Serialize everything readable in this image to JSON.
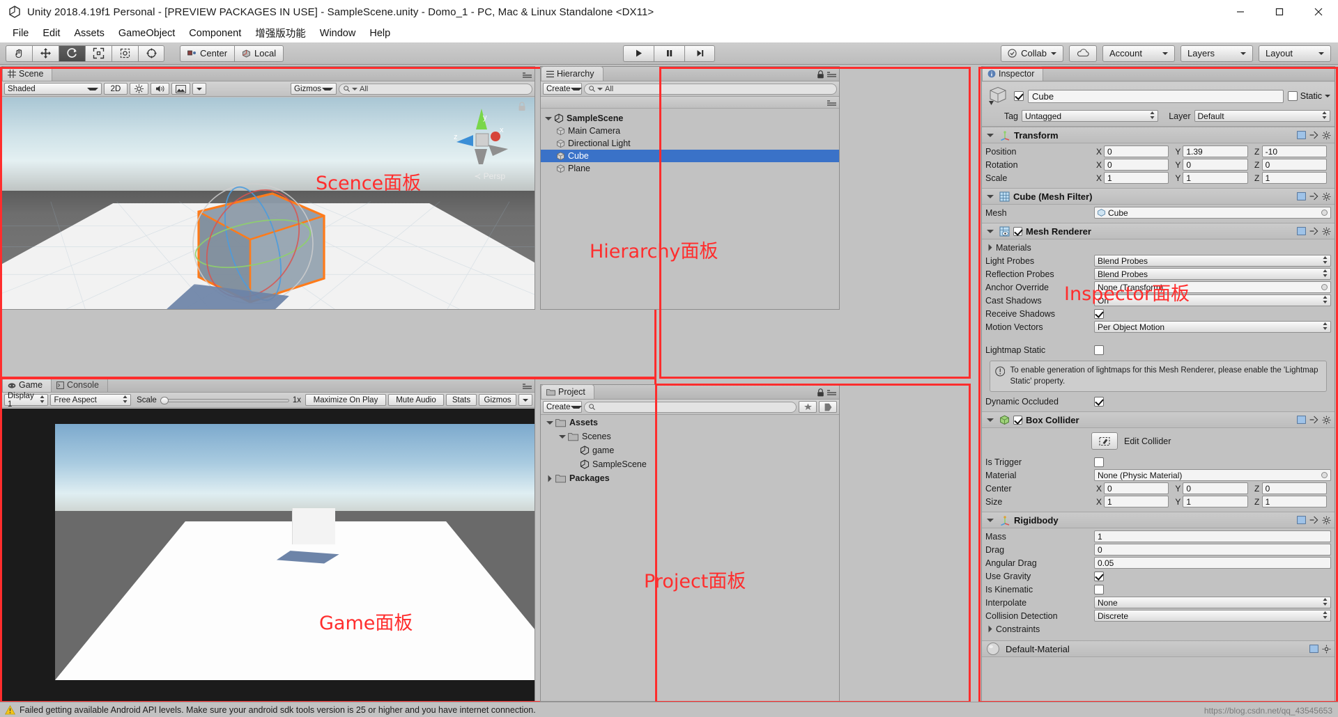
{
  "window": {
    "title": "Unity 2018.4.19f1 Personal - [PREVIEW PACKAGES IN USE] - SampleScene.unity - Domo_1 - PC, Mac & Linux Standalone <DX11>",
    "minimize_label": "Minimize",
    "maximize_label": "Maximize",
    "close_label": "Close"
  },
  "menu": {
    "items": [
      "File",
      "Edit",
      "Assets",
      "GameObject",
      "Component",
      "增强版功能",
      "Window",
      "Help"
    ]
  },
  "toolbar": {
    "tools": [
      "hand-tool",
      "move-tool",
      "rotate-tool",
      "scale-tool",
      "rect-tool",
      "transform-tool"
    ],
    "active_tool_index": 2,
    "pivot_label": "Center",
    "space_label": "Local",
    "play_label": "Play",
    "pause_label": "Pause",
    "step_label": "Step",
    "collab_label": "Collab",
    "cloud_label": "Services",
    "account_label": "Account",
    "layers_label": "Layers",
    "layout_label": "Layout"
  },
  "scene": {
    "tab_label": "Scene",
    "shading_mode": "Shaded",
    "mode_2d": "2D",
    "gizmos_label": "Gizmos",
    "search_placeholder": "All",
    "perspective_label": "Persp",
    "axis_labels": {
      "x": "x",
      "y": "y",
      "z": "z"
    },
    "annotation": "Scence面板"
  },
  "hierarchy": {
    "tab_label": "Hierarchy",
    "create_label": "Create",
    "search_placeholder": "All",
    "items": [
      {
        "label": "SampleScene",
        "depth": 0,
        "icon": "unity-icon",
        "selected": false,
        "expanded": true
      },
      {
        "label": "Main Camera",
        "depth": 1,
        "icon": "gameobject-icon",
        "selected": false
      },
      {
        "label": "Directional Light",
        "depth": 1,
        "icon": "gameobject-icon",
        "selected": false
      },
      {
        "label": "Cube",
        "depth": 1,
        "icon": "gameobject-icon",
        "selected": true
      },
      {
        "label": "Plane",
        "depth": 1,
        "icon": "gameobject-icon",
        "selected": false
      }
    ],
    "annotation": "Hierarchy面板"
  },
  "game": {
    "tab_label": "Game",
    "console_tab_label": "Console",
    "display_label": "Display 1",
    "aspect_label": "Free Aspect",
    "scale_label": "Scale",
    "scale_value": "1x",
    "maximize_label": "Maximize On Play",
    "mute_label": "Mute Audio",
    "stats_label": "Stats",
    "gizmos_label": "Gizmos",
    "annotation": "Game面板"
  },
  "project": {
    "tab_label": "Project",
    "create_label": "Create",
    "search_placeholder": "",
    "items": [
      {
        "label": "Assets",
        "depth": 0,
        "icon": "folder-icon",
        "expanded": true,
        "bold": true
      },
      {
        "label": "Scenes",
        "depth": 1,
        "icon": "folder-icon",
        "expanded": true,
        "bold": false
      },
      {
        "label": "game",
        "depth": 2,
        "icon": "unity-scene-icon",
        "bold": false
      },
      {
        "label": "SampleScene",
        "depth": 2,
        "icon": "unity-scene-icon",
        "bold": false
      },
      {
        "label": "Packages",
        "depth": 0,
        "icon": "folder-icon",
        "expanded": false,
        "bold": true
      }
    ],
    "annotation": "Project面板"
  },
  "inspector": {
    "tab_label": "Inspector",
    "annotation": "Inspector面板",
    "object_name": "Cube",
    "object_enabled": true,
    "static_label": "Static",
    "static_checked": false,
    "tag_label": "Tag",
    "tag_value": "Untagged",
    "layer_label": "Layer",
    "layer_value": "Default",
    "components": [
      {
        "name": "Transform",
        "icon": "transform-icon",
        "enabled_toggle": false,
        "rows": [
          {
            "type": "vec3",
            "label": "Position",
            "x": "0",
            "y": "1.39",
            "z": "-10"
          },
          {
            "type": "vec3",
            "label": "Rotation",
            "x": "0",
            "y": "0",
            "z": "0"
          },
          {
            "type": "vec3",
            "label": "Scale",
            "x": "1",
            "y": "1",
            "z": "1"
          }
        ]
      },
      {
        "name": "Cube (Mesh Filter)",
        "icon": "mesh-filter-icon",
        "enabled_toggle": false,
        "rows": [
          {
            "type": "object",
            "label": "Mesh",
            "value": "Cube"
          }
        ]
      },
      {
        "name": "Mesh Renderer",
        "icon": "mesh-renderer-icon",
        "enabled_toggle": true,
        "enabled": true,
        "rows": [
          {
            "type": "foldout",
            "label": "Materials"
          },
          {
            "type": "popup",
            "label": "Light Probes",
            "value": "Blend Probes"
          },
          {
            "type": "popup",
            "label": "Reflection Probes",
            "value": "Blend Probes"
          },
          {
            "type": "object",
            "label": "Anchor Override",
            "value": "None (Transform)"
          },
          {
            "type": "popup",
            "label": "Cast Shadows",
            "value": "On"
          },
          {
            "type": "checkbox",
            "label": "Receive Shadows",
            "checked": true
          },
          {
            "type": "popup",
            "label": "Motion Vectors",
            "value": "Per Object Motion"
          },
          {
            "type": "checkbox",
            "label": "Lightmap Static",
            "checked": false
          },
          {
            "type": "infobox",
            "text": "To enable generation of lightmaps for this Mesh Renderer, please enable the 'Lightmap Static' property."
          },
          {
            "type": "checkbox",
            "label": "Dynamic Occluded",
            "checked": true
          }
        ]
      },
      {
        "name": "Box Collider",
        "icon": "box-collider-icon",
        "enabled_toggle": true,
        "enabled": true,
        "rows": [
          {
            "type": "editcollider",
            "label": "Edit Collider"
          },
          {
            "type": "checkbox",
            "label": "Is Trigger",
            "checked": false
          },
          {
            "type": "object",
            "label": "Material",
            "value": "None (Physic Material)"
          },
          {
            "type": "vec3",
            "label": "Center",
            "x": "0",
            "y": "0",
            "z": "0"
          },
          {
            "type": "vec3",
            "label": "Size",
            "x": "1",
            "y": "1",
            "z": "1"
          }
        ]
      },
      {
        "name": "Rigidbody",
        "icon": "rigidbody-icon",
        "enabled_toggle": false,
        "rows": [
          {
            "type": "text",
            "label": "Mass",
            "value": "1"
          },
          {
            "type": "text",
            "label": "Drag",
            "value": "0"
          },
          {
            "type": "text",
            "label": "Angular Drag",
            "value": "0.05"
          },
          {
            "type": "checkbox",
            "label": "Use Gravity",
            "checked": true
          },
          {
            "type": "checkbox",
            "label": "Is Kinematic",
            "checked": false
          },
          {
            "type": "popup",
            "label": "Interpolate",
            "value": "None"
          },
          {
            "type": "popup",
            "label": "Collision Detection",
            "value": "Discrete"
          },
          {
            "type": "foldout",
            "label": "Constraints"
          }
        ]
      }
    ],
    "material_footer": "Default-Material"
  },
  "statusbar": {
    "message": "Failed getting available Android API levels. Make sure your android sdk tools version is 25 or higher and you have internet connection.",
    "watermark": "https://blog.csdn.net/qq_43545653"
  },
  "colors": {
    "selection_blue": "#3a72c8",
    "annotation_red": "#ff2d2d",
    "panel_gray": "#c2c2c2",
    "selected_outline_orange": "#ff7b1a"
  }
}
